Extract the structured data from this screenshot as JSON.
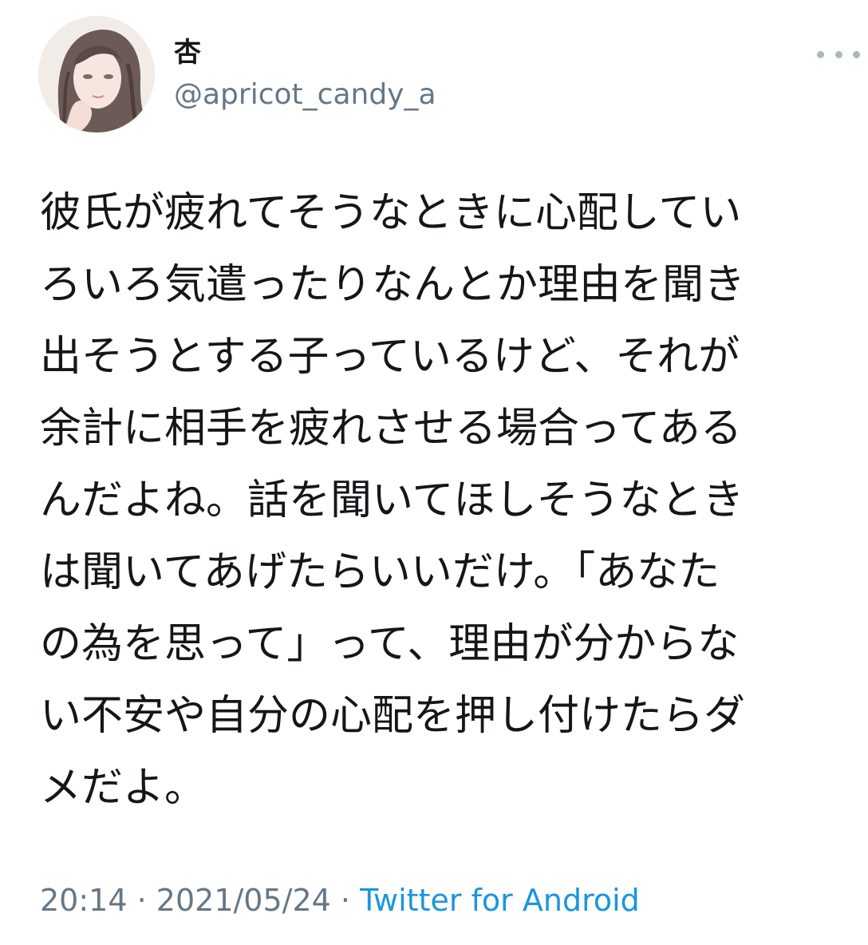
{
  "tweet": {
    "display_name": "杏",
    "handle": "@apricot_candy_a",
    "more_icon": "more-horizontal-icon",
    "body_lines": [
      "彼氏が疲れてそうなときに心配してい",
      "ろいろ気遣ったりなんとか理由を聞き",
      "出そうとする子っているけど、それが",
      "余計に相手を疲れさせる場合ってある",
      "んだよね。話を聞いてほしそうなとき",
      "は聞いてあげたらいいだけ。「あなた",
      "の為を思って」って、理由が分からな",
      "い不安や自分の心配を押し付けたらダ",
      "メだよ。"
    ],
    "time": "20:14",
    "separator": "·",
    "date": "2021/05/24",
    "source": "Twitter for Android"
  },
  "colors": {
    "text": "#14171a",
    "secondary": "#657786",
    "link": "#1b95e0"
  }
}
